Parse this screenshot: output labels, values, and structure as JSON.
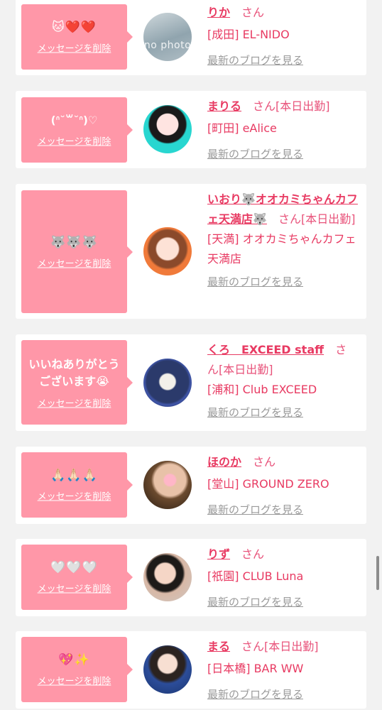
{
  "cards": [
    {
      "message": "🐱❤️❤️",
      "delete_label": "メッセージを削除",
      "name": "りか",
      "san": "さん",
      "status": "",
      "store": "[成田] EL-NIDO",
      "blog_label": "最新のブログを見る",
      "avatar": "no-photo",
      "avatar_text": "no photo"
    },
    {
      "message": "(ᐢ˘꒳˘ᐢ)♡",
      "delete_label": "メッセージを削除",
      "name": "まりる",
      "san": "さん",
      "status": "[本日出勤]",
      "store": "[町田] eAlice",
      "blog_label": "最新のブログを見る",
      "avatar": "photo-cyan"
    },
    {
      "message": "🐺🐺🐺",
      "delete_label": "メッセージを削除",
      "name": "いおり🐺オオカミちゃんカフェ天満店🐺",
      "san": "さん",
      "status": "[本日出勤]",
      "store": "[天満] オオカミちゃんカフェ天満店",
      "blog_label": "最新のブログを見る",
      "avatar": "photo-orange"
    },
    {
      "message": "いいねありがとうございます😭",
      "delete_label": "メッセージを削除",
      "name": "くろ　EXCEED staff",
      "san": "さん",
      "status": "[本日出勤]",
      "store": "[浦和] Club EXCEED",
      "blog_label": "最新のブログを見る",
      "avatar": "photo-blue"
    },
    {
      "message": "🙏🏻🙏🏻🙏🏻",
      "delete_label": "メッセージを削除",
      "name": "ほのか",
      "san": "さん",
      "status": "",
      "store": "[堂山] GROUND ZERO",
      "blog_label": "最新のブログを見る",
      "avatar": "photo-dark"
    },
    {
      "message": "🤍🤍🤍",
      "delete_label": "メッセージを削除",
      "name": "りず",
      "san": "さん",
      "status": "",
      "store": "[祇園] CLUB Luna",
      "blog_label": "最新のブログを見る",
      "avatar": "photo-beige"
    },
    {
      "message": "💖✨",
      "delete_label": "メッセージを削除",
      "name": "まる",
      "san": "さん",
      "status": "[本日出勤]",
      "store": "[日本橋] BAR WW",
      "blog_label": "最新のブログを見る",
      "avatar": "photo-navy"
    }
  ],
  "colors": {
    "bubble": "#ff97a8",
    "accent": "#e83a62",
    "muted": "#9a9a9a",
    "background": "#f2f2f2"
  }
}
